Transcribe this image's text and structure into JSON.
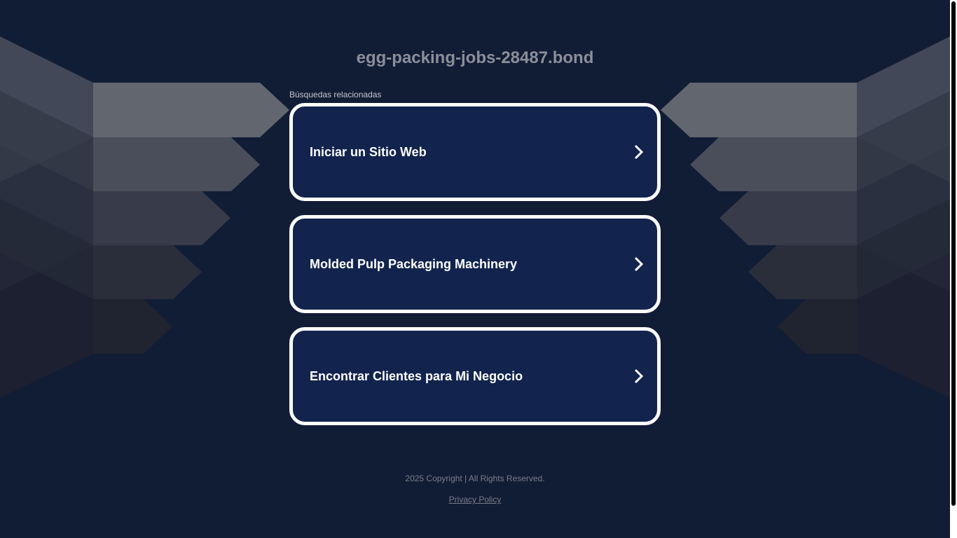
{
  "header": {
    "domain": "egg-packing-jobs-28487.bond"
  },
  "related": {
    "label": "Búsquedas relacionadas",
    "items": [
      {
        "label": "Iniciar un Sitio Web"
      },
      {
        "label": "Molded Pulp Packaging Machinery"
      },
      {
        "label": "Encontrar Clientes para Mi Negocio"
      }
    ]
  },
  "footer": {
    "copyright": "2025 Copyright | All Rights Reserved.",
    "privacy": "Privacy Policy"
  },
  "colors": {
    "background": "#111c35",
    "card": "#12244d",
    "card_border": "#ffffff",
    "muted_text": "#8b8f99"
  }
}
